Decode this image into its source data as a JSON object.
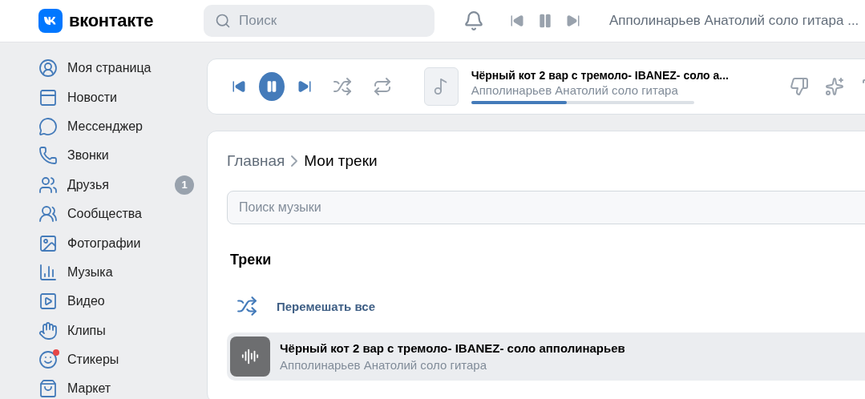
{
  "header": {
    "logo_text": "вконтакте",
    "search": {
      "placeholder": "Поиск"
    },
    "now_playing": "Апполинарьев Анатолий соло гитара ...",
    "playing": true
  },
  "sidebar": {
    "items": [
      {
        "label": "Моя страница"
      },
      {
        "label": "Новости"
      },
      {
        "label": "Мессенджер"
      },
      {
        "label": "Звонки"
      },
      {
        "label": "Друзья",
        "badge": "1"
      },
      {
        "label": "Сообщества"
      },
      {
        "label": "Фотографии"
      },
      {
        "label": "Музыка"
      },
      {
        "label": "Видео"
      },
      {
        "label": "Клипы"
      },
      {
        "label": "Стикеры",
        "dot": true
      },
      {
        "label": "Маркет"
      }
    ]
  },
  "player": {
    "playing": true,
    "title": "Чёрный кот 2 вар с тремоло- IBANEZ- соло а...",
    "artist": "Апполинарьев Анатолий соло гитара",
    "level": 0.43
  },
  "breadcrumbs": [
    "Главная",
    "Мои треки"
  ],
  "music_search": {
    "placeholder": "Поиск музыки"
  },
  "section_title": "Треки",
  "shuffle_all": "Перемешать все",
  "tracks": [
    {
      "title": "Чёрный кот 2 вар с тремоло- IBANEZ- соло апполинарьев",
      "artist": "Апполинарьев Анатолий соло гитара",
      "selected": true
    }
  ]
}
